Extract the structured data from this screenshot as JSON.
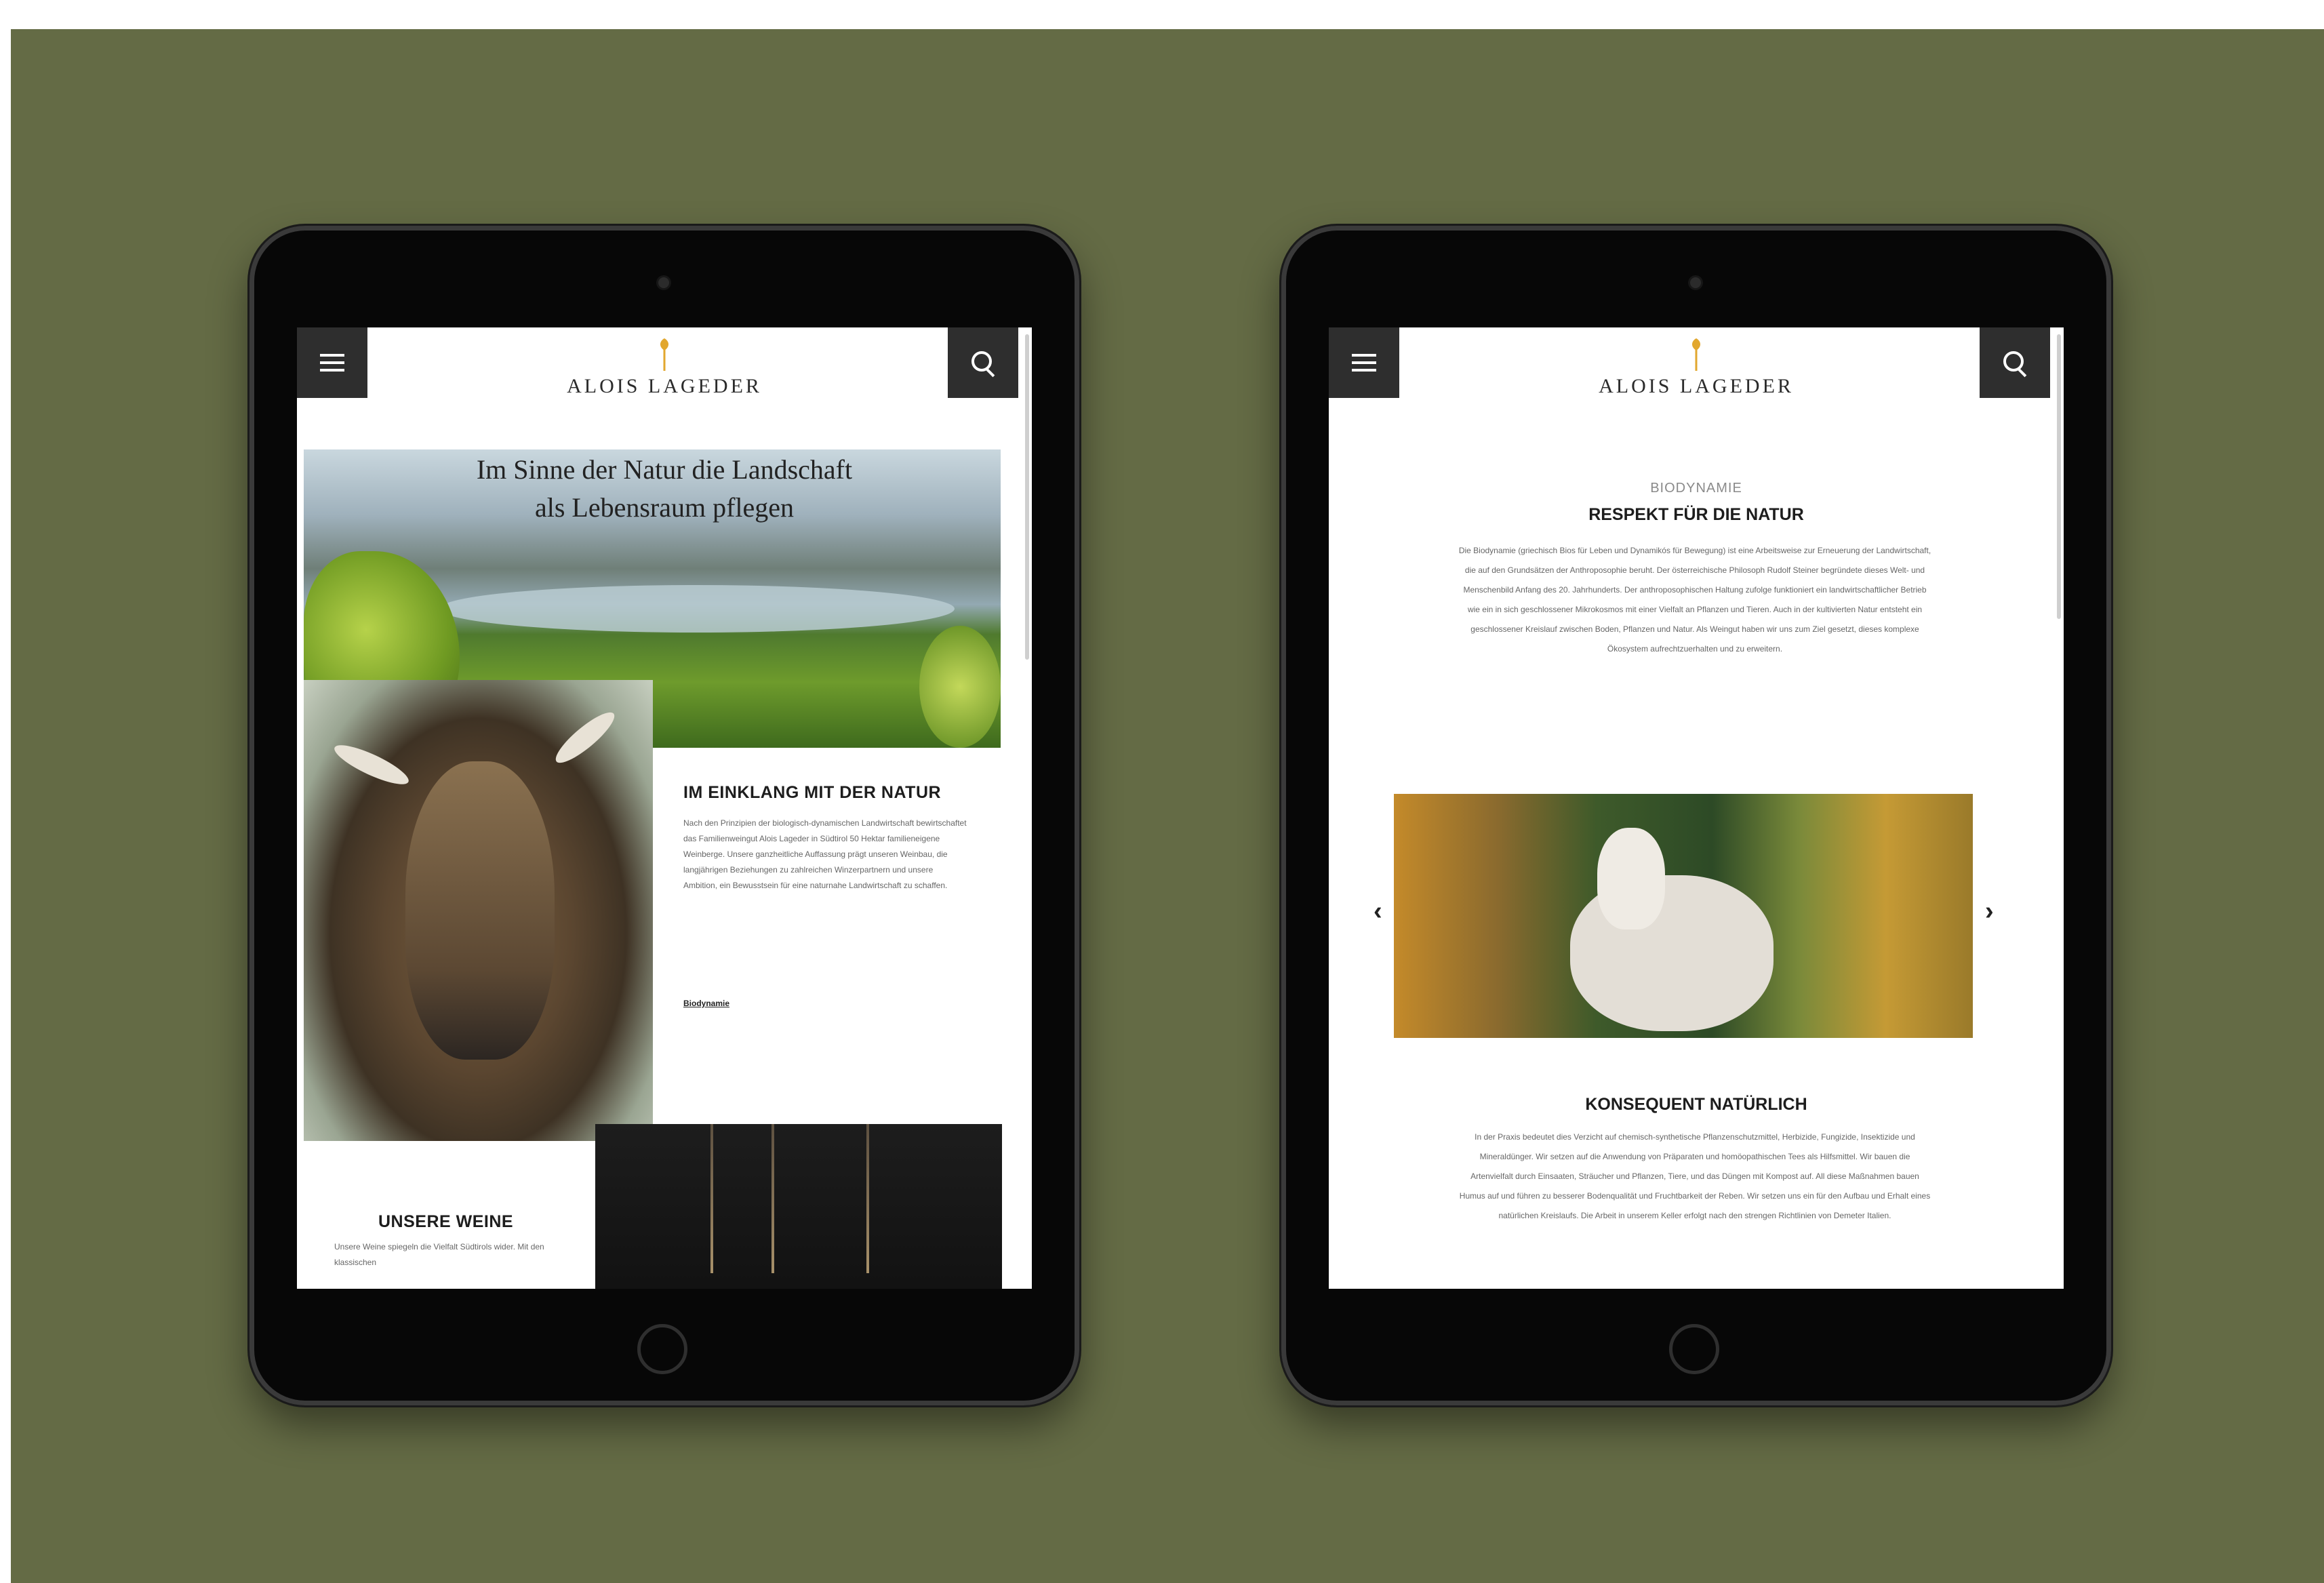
{
  "left_tablet": {
    "brand": "ALOIS LAGEDER",
    "hero_title_line1": "Im Sinne der Natur die Landschaft",
    "hero_title_line2": "als Lebensraum pflegen",
    "section1": {
      "title": "IM EINKLANG MIT DER NATUR",
      "body": "Nach den Prinzipien der biologisch-dynamischen Landwirtschaft bewirtschaftet das Familienweingut Alois Lageder in Südtirol 50 Hektar familieneigene Weinberge. Unsere ganzheitliche Auffassung prägt unseren Weinbau, die langjährigen Beziehungen zu zahlreichen Winzerpartnern und unsere Ambition, ein Bewusstsein für eine naturnahe Landwirtschaft zu schaffen.",
      "link": "Biodynamie"
    },
    "section2": {
      "title": "UNSERE WEINE",
      "body": "Unsere Weine spiegeln die Vielfalt Südtirols wider. Mit den klassischen"
    }
  },
  "right_tablet": {
    "brand": "ALOIS LAGEDER",
    "kicker": "BIODYNAMIE",
    "section1": {
      "title": "RESPEKT FÜR DIE NATUR",
      "body": "Die Biodynamie (griechisch Bios für Leben und Dynamikós für Bewegung) ist eine Arbeitsweise zur Erneuerung der Landwirtschaft, die auf den Grundsätzen der Anthroposophie beruht. Der österreichische Philosoph Rudolf Steiner begründete dieses Welt- und Menschenbild Anfang des 20. Jahrhunderts. Der anthroposophischen Haltung zufolge funktioniert ein landwirtschaftlicher Betrieb wie ein in sich geschlossener Mikrokosmos mit einer Vielfalt an Pflanzen und Tieren. Auch in der kultivierten Natur entsteht ein geschlossener Kreislauf zwischen Boden, Pflanzen und Natur. Als Weingut haben wir uns zum Ziel gesetzt, dieses komplexe Ökosystem aufrechtzuerhalten und zu erweitern."
    },
    "slider": {
      "prev": "‹",
      "next": "›"
    },
    "section2": {
      "title": "KONSEQUENT NATÜRLICH",
      "body": "In der Praxis bedeutet dies Verzicht auf chemisch-synthetische Pflanzenschutzmittel, Herbizide, Fungizide, Insektizide und Mineraldünger. Wir setzen auf die Anwendung von Präparaten und homöopathischen Tees als Hilfsmittel. Wir bauen die Artenvielfalt durch Einsaaten, Sträucher und Pflanzen, Tiere, und das Düngen mit Kompost auf. All diese Maßnahmen bauen Humus auf und führen zu besserer Bodenqualität und Fruchtbarkeit der Reben. Wir setzen uns ein für den Aufbau und Erhalt eines natürlichen Kreislaufs. Die Arbeit in unserem Keller erfolgt nach den strengen Richtlinien von Demeter Italien."
    }
  },
  "colors": {
    "background": "#646b45",
    "device": "#070707",
    "accent_gold": "#e2a72e",
    "header_button": "#2e2e2e"
  },
  "icons": [
    "menu-icon",
    "search-icon",
    "logo-icon",
    "chevron-left-icon",
    "chevron-right-icon"
  ]
}
